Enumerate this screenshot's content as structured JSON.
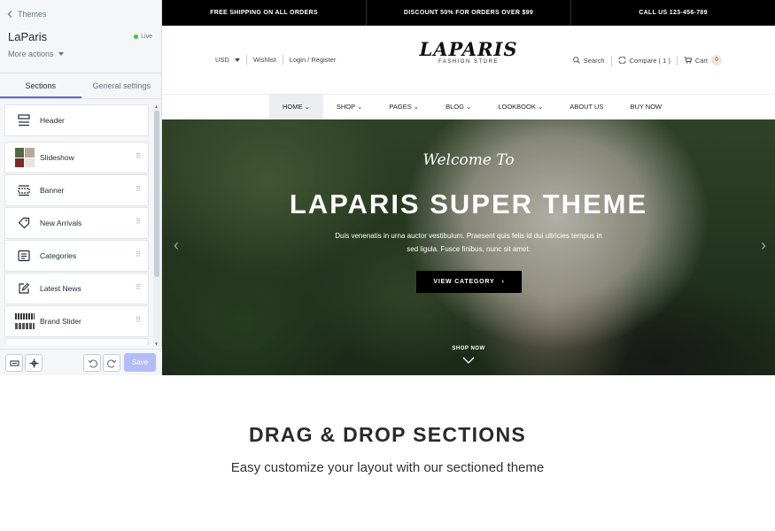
{
  "sidebar": {
    "back_label": "Themes",
    "theme_name": "LaParis",
    "status": "Live",
    "more_actions": "More actions",
    "tabs": [
      {
        "label": "Sections"
      },
      {
        "label": "General settings"
      }
    ],
    "sections": [
      {
        "label": "Header",
        "icon": "header-icon"
      },
      {
        "label": "Slideshow",
        "icon": "slideshow-thumbnail"
      },
      {
        "label": "Banner",
        "icon": "banner-icon"
      },
      {
        "label": "New Arrivals",
        "icon": "tag-icon"
      },
      {
        "label": "Categories",
        "icon": "categories-icon"
      },
      {
        "label": "Latest News",
        "icon": "edit-icon"
      },
      {
        "label": "Brand Slider",
        "icon": "brand-thumbnail"
      }
    ],
    "save_label": "Save",
    "accent_color": "#5c6ac4",
    "live_color": "#50b83c"
  },
  "store": {
    "topbar": [
      "FREE SHIPPING ON ALL ORDERS",
      "DISCOUNT 50% FOR ORDERS OVER $99",
      "CALL US 123-456-789"
    ],
    "currency": "USD",
    "wishlist": "Wishlist",
    "login": "Login / Register",
    "logo_main": "LAPARIS",
    "logo_sub": "FASHION STORE",
    "search": "Search",
    "compare": "Compare ( 1 )",
    "cart": "Cart",
    "cart_count": "0",
    "nav": [
      {
        "label": "HOME"
      },
      {
        "label": "SHOP"
      },
      {
        "label": "PAGES"
      },
      {
        "label": "BLOG"
      },
      {
        "label": "LOOKBOOK"
      },
      {
        "label": "ABOUT US"
      },
      {
        "label": "BUY NOW"
      }
    ],
    "hero": {
      "welcome": "Welcome To",
      "title": "LAPARIS SUPER THEME",
      "desc_line1": "Duis venenatis in urna auctor vestibulum. Praesent quis felis id dui ultricies tempus in",
      "desc_line2": "sed ligula. Fusce finibus, nunc sit amet.",
      "cta": "VIEW CATEGORY",
      "scroll_label": "SHOP NOW"
    }
  },
  "marketing": {
    "headline": "DRAG & DROP SECTIONS",
    "subline": "Easy customize your layout with our sectioned theme"
  }
}
